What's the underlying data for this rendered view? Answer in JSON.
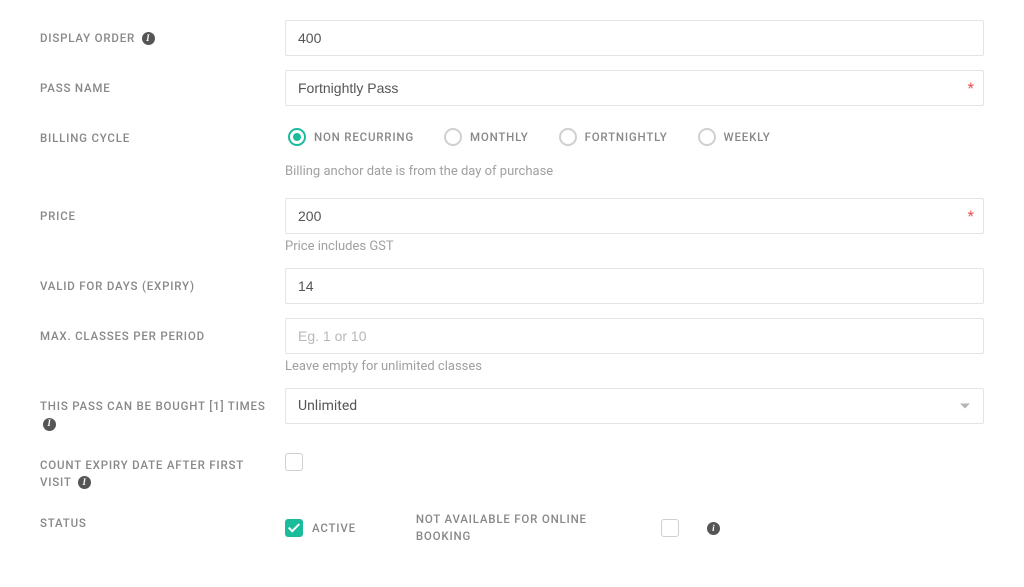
{
  "labels": {
    "display_order": "DISPLAY ORDER",
    "pass_name": "PASS NAME",
    "billing_cycle": "BILLING CYCLE",
    "price": "PRICE",
    "valid_for_days": "VALID FOR DAYS (EXPIRY)",
    "max_classes": "MAX. CLASSES PER PERIOD",
    "purchase_limit": "THIS PASS CAN BE BOUGHT [1] TIMES",
    "count_expiry": "COUNT EXPIRY DATE AFTER FIRST VISIT",
    "status": "STATUS"
  },
  "values": {
    "display_order": "400",
    "pass_name": "Fortnightly Pass",
    "price": "200",
    "valid_for_days": "14",
    "max_classes": "",
    "purchase_limit": "Unlimited"
  },
  "placeholders": {
    "max_classes": "Eg. 1 or 10"
  },
  "hints": {
    "billing_anchor": "Billing anchor date is from the day of purchase",
    "price_gst": "Price includes GST",
    "max_classes_empty": "Leave empty for unlimited classes"
  },
  "billing_cycle": {
    "options": [
      "NON RECURRING",
      "MONTHLY",
      "FORTNIGHTLY",
      "WEEKLY"
    ],
    "selected": "NON RECURRING"
  },
  "status_options": {
    "active": "ACTIVE",
    "not_available_online": "NOT AVAILABLE FOR ONLINE BOOKING"
  }
}
